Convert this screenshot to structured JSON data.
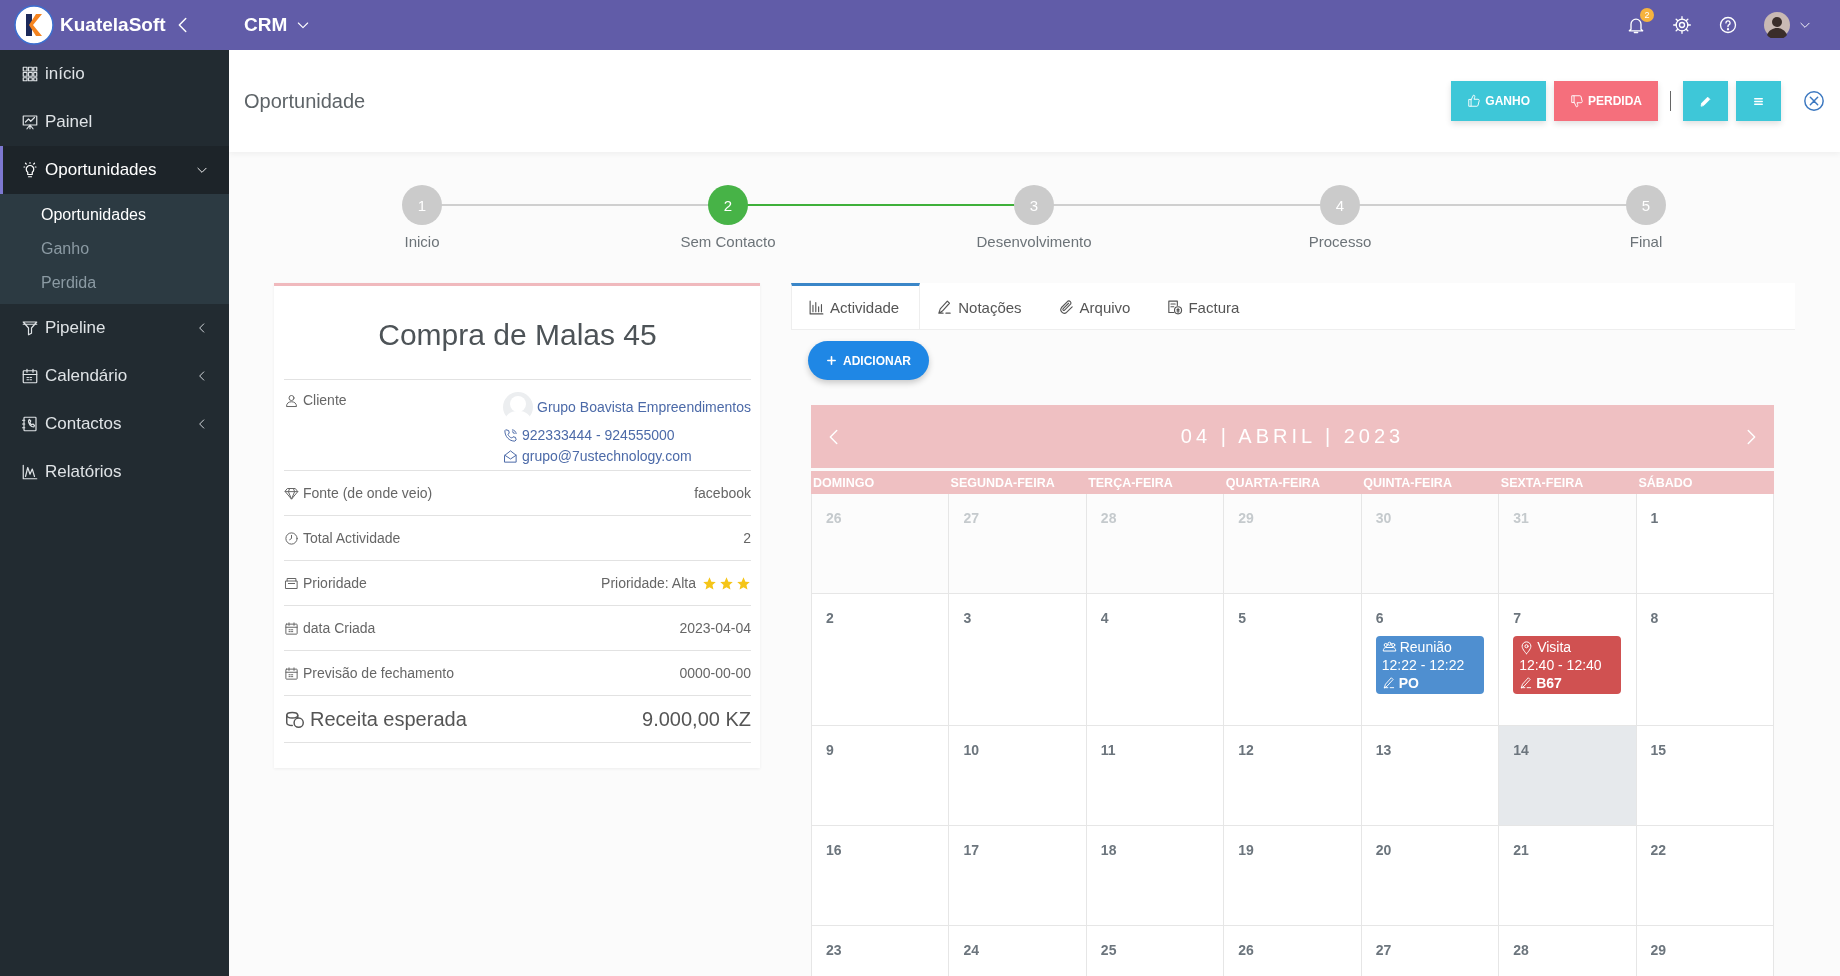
{
  "topbar": {
    "brand": "KuatelaSoft",
    "module": "CRM",
    "notifications": "2"
  },
  "sidebar": {
    "items": [
      {
        "kind": "link",
        "label": "início",
        "selected": false
      },
      {
        "kind": "link",
        "label": "Painel",
        "selected": false
      },
      {
        "kind": "group",
        "label": "Oportunidades",
        "selected": true,
        "expanded": true,
        "children": [
          {
            "label": "Oportunidades",
            "selected": true
          },
          {
            "label": "Ganho",
            "selected": false
          },
          {
            "label": "Perdida",
            "selected": false
          }
        ]
      },
      {
        "kind": "group",
        "label": "Pipeline",
        "selected": false,
        "expanded": false
      },
      {
        "kind": "group",
        "label": "Calendário",
        "selected": false,
        "expanded": false
      },
      {
        "kind": "group",
        "label": "Contactos",
        "selected": false,
        "expanded": false
      },
      {
        "kind": "link",
        "label": "Relatórios",
        "selected": false
      }
    ]
  },
  "header": {
    "title": "Oportunidade",
    "buttons": [
      {
        "kind": "won",
        "label": "GANHO"
      },
      {
        "kind": "lost",
        "label": "PERDIDA"
      },
      {
        "kind": "edit"
      },
      {
        "kind": "menu"
      }
    ]
  },
  "stepper": {
    "steps": [
      {
        "number": "1",
        "label": "Inicio",
        "selected": false
      },
      {
        "number": "2",
        "label": "Sem Contacto",
        "selected": true
      },
      {
        "number": "3",
        "label": "Desenvolvimento",
        "selected": false
      },
      {
        "number": "4",
        "label": "Processo",
        "selected": false
      },
      {
        "number": "5",
        "label": "Final",
        "selected": false
      }
    ]
  },
  "card": {
    "title": "Compra de Malas 45",
    "rows": [
      {
        "kind": "client",
        "label": "Cliente",
        "name": "Grupo Boavista Empreendimentos",
        "phone": "922333444 - 924555000",
        "email": "grupo@7ustechnology.com"
      },
      {
        "kind": "text",
        "label": "Fonte (de onde veio)",
        "value": "facebook"
      },
      {
        "kind": "text",
        "label": "Total Actividade",
        "value": "2"
      },
      {
        "kind": "priority",
        "label": "Prioridade",
        "value": "Prioridade: Alta",
        "stars": 3
      },
      {
        "kind": "text",
        "label": "data Criada",
        "value": "2023-04-04"
      },
      {
        "kind": "text",
        "label": "Previsão de fechamento",
        "value": "0000-00-00"
      },
      {
        "kind": "total",
        "label": "Receita esperada",
        "value": "9.000,00 KZ"
      }
    ]
  },
  "activity": {
    "tabs": [
      {
        "label": "Actividade",
        "selected": true
      },
      {
        "label": "Notações",
        "selected": false
      },
      {
        "label": "Arquivo",
        "selected": false
      },
      {
        "label": "Factura",
        "selected": false
      }
    ],
    "add_button": "ADICIONAR",
    "calendar": {
      "title": "04 | ABRIL | 2023",
      "weekdays": [
        "DOMINGO",
        "SEGUNDA-FEIRA",
        "TERÇA-FEIRA",
        "QUARTA-FEIRA",
        "QUINTA-FEIRA",
        "SEXTA-FEIRA",
        "SÁBADO"
      ],
      "weeks": [
        [
          {
            "day": "26",
            "other_month": true,
            "highlighted": false
          },
          {
            "day": "27",
            "other_month": true,
            "highlighted": false
          },
          {
            "day": "28",
            "other_month": true,
            "highlighted": false
          },
          {
            "day": "29",
            "other_month": true,
            "highlighted": false
          },
          {
            "day": "30",
            "other_month": true,
            "highlighted": false
          },
          {
            "day": "31",
            "other_month": true,
            "highlighted": false
          },
          {
            "day": "1",
            "other_month": false,
            "highlighted": false
          }
        ],
        [
          {
            "day": "2",
            "other_month": false,
            "highlighted": false
          },
          {
            "day": "3",
            "other_month": false,
            "highlighted": false
          },
          {
            "day": "4",
            "other_month": false,
            "highlighted": false
          },
          {
            "day": "5",
            "other_month": false,
            "highlighted": false
          },
          {
            "day": "6",
            "other_month": false,
            "highlighted": false,
            "events": [
              {
                "kind": "meeting",
                "color": "#4f8fd0",
                "title": "Reunião",
                "time": "12:22 - 12:22",
                "note": "PO"
              }
            ]
          },
          {
            "day": "7",
            "other_month": false,
            "highlighted": false,
            "events": [
              {
                "kind": "visit",
                "color": "#d05151",
                "title": "Visita",
                "time": "12:40 - 12:40",
                "note": "B67"
              }
            ]
          },
          {
            "day": "8",
            "other_month": false,
            "highlighted": false
          }
        ],
        [
          {
            "day": "9",
            "other_month": false,
            "highlighted": false
          },
          {
            "day": "10",
            "other_month": false,
            "highlighted": false
          },
          {
            "day": "11",
            "other_month": false,
            "highlighted": false
          },
          {
            "day": "12",
            "other_month": false,
            "highlighted": false
          },
          {
            "day": "13",
            "other_month": false,
            "highlighted": false
          },
          {
            "day": "14",
            "other_month": false,
            "highlighted": true
          },
          {
            "day": "15",
            "other_month": false,
            "highlighted": false
          }
        ],
        [
          {
            "day": "16",
            "other_month": false,
            "highlighted": false
          },
          {
            "day": "17",
            "other_month": false,
            "highlighted": false
          },
          {
            "day": "18",
            "other_month": false,
            "highlighted": false
          },
          {
            "day": "19",
            "other_month": false,
            "highlighted": false
          },
          {
            "day": "20",
            "other_month": false,
            "highlighted": false
          },
          {
            "day": "21",
            "other_month": false,
            "highlighted": false
          },
          {
            "day": "22",
            "other_month": false,
            "highlighted": false
          }
        ],
        [
          {
            "day": "23",
            "other_month": false,
            "highlighted": false
          },
          {
            "day": "24",
            "other_month": false,
            "highlighted": false
          },
          {
            "day": "25",
            "other_month": false,
            "highlighted": false
          },
          {
            "day": "26",
            "other_month": false,
            "highlighted": false
          },
          {
            "day": "27",
            "other_month": false,
            "highlighted": false
          },
          {
            "day": "28",
            "other_month": false,
            "highlighted": false
          },
          {
            "day": "29",
            "other_month": false,
            "highlighted": false
          }
        ]
      ]
    }
  }
}
